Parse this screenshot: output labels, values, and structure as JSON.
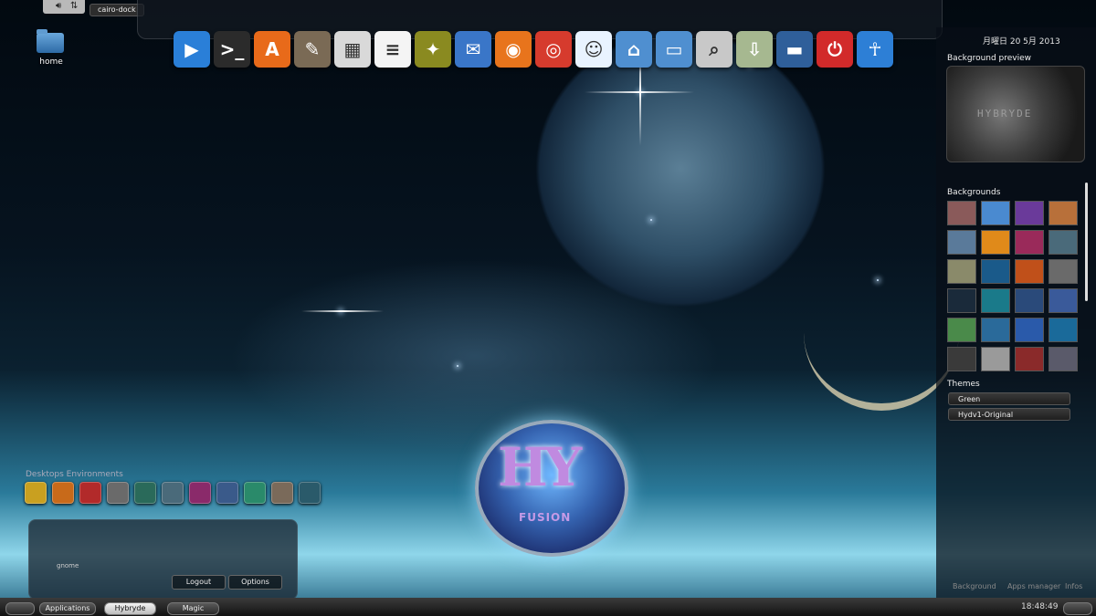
{
  "tray": {
    "icons": [
      "speaker-icon",
      "network-icon"
    ],
    "window_title": "cairo-dock"
  },
  "desktop": {
    "home_label": "home"
  },
  "dock": {
    "items": [
      {
        "name": "media-player-icon",
        "glyph": "▶",
        "color": "#2a7fd8"
      },
      {
        "name": "terminal-icon",
        "glyph": ">_",
        "color": "#2b2b2b"
      },
      {
        "name": "software-center-icon",
        "glyph": "A",
        "color": "#e86a1a"
      },
      {
        "name": "gimp-icon",
        "glyph": "✎",
        "color": "#7a6a55"
      },
      {
        "name": "calculator-icon",
        "glyph": "▦",
        "color": "#d9d9d9"
      },
      {
        "name": "text-editor-icon",
        "glyph": "≡",
        "color": "#f4f4f4"
      },
      {
        "name": "image-viewer-icon",
        "glyph": "✦",
        "color": "#8a8a20"
      },
      {
        "name": "thunderbird-icon",
        "glyph": "✉",
        "color": "#3a76c8"
      },
      {
        "name": "firefox-icon",
        "glyph": "◉",
        "color": "#e8741c"
      },
      {
        "name": "chrome-icon",
        "glyph": "◎",
        "color": "#d63b2d"
      },
      {
        "name": "messenger-icon",
        "glyph": "☺",
        "color": "#e9f3ff"
      },
      {
        "name": "home-folder-icon",
        "glyph": "⌂",
        "color": "#4f8fd0"
      },
      {
        "name": "folder-icon",
        "glyph": "▭",
        "color": "#4f8fd0"
      },
      {
        "name": "search-clock-icon",
        "glyph": "⌕",
        "color": "#c8c8c8"
      },
      {
        "name": "downloads-icon",
        "glyph": "⇩",
        "color": "#a6b890"
      },
      {
        "name": "desktop-icon",
        "glyph": "▬",
        "color": "#2f5f9a"
      },
      {
        "name": "power-icon",
        "glyph": "⏻",
        "color": "#d22a2a"
      },
      {
        "name": "accessibility-icon",
        "glyph": "☥",
        "color": "#2d7fd6"
      }
    ]
  },
  "right_panel": {
    "date": "月曜日 20 5月 2013",
    "background_preview_title": "Background preview",
    "preview_text": "HYBRYDE",
    "backgrounds_title": "Backgrounds",
    "thumb_colors": [
      "#8a5a5a",
      "#4a8ad0",
      "#6a3a9a",
      "#b8703a",
      "#5a7a9a",
      "#e08a1a",
      "#9a2a5a",
      "#4a6a7a",
      "#8a8a6a",
      "#1a5a8a",
      "#c0501a",
      "#6a6a6a",
      "#1a2a3a",
      "#1a7a8a",
      "#2a4a7a",
      "#3a5a9a",
      "#4a8a4a",
      "#2a6a9a",
      "#2a5aaa",
      "#1a6a9a",
      "#3a3a3a",
      "#9a9a9a",
      "#8a2a2a",
      "#5a5a6a"
    ],
    "themes_title": "Themes",
    "themes": [
      "Green",
      "Hydv1-Original"
    ],
    "links": [
      "Background",
      "Apps manager",
      "Infos"
    ]
  },
  "desktops_environments": {
    "title": "Desktops Environments",
    "colors": [
      "#c9a020",
      "#c86a1a",
      "#b22a2a",
      "#6a6a6a",
      "#2a6a5a",
      "#4a6a7a",
      "#8a2a6a",
      "#3a5a8a",
      "#2a8a6a",
      "#7a6a5a",
      "#2a5a6a"
    ],
    "user": "gnome",
    "logout": "Logout",
    "options": "Options"
  },
  "bottom_bar": {
    "applications": "Applications",
    "hybryde": "Hybryde",
    "magic": "Magic",
    "time": "18:48:49"
  },
  "logo": {
    "main": "HY",
    "sub": "FUSION"
  }
}
